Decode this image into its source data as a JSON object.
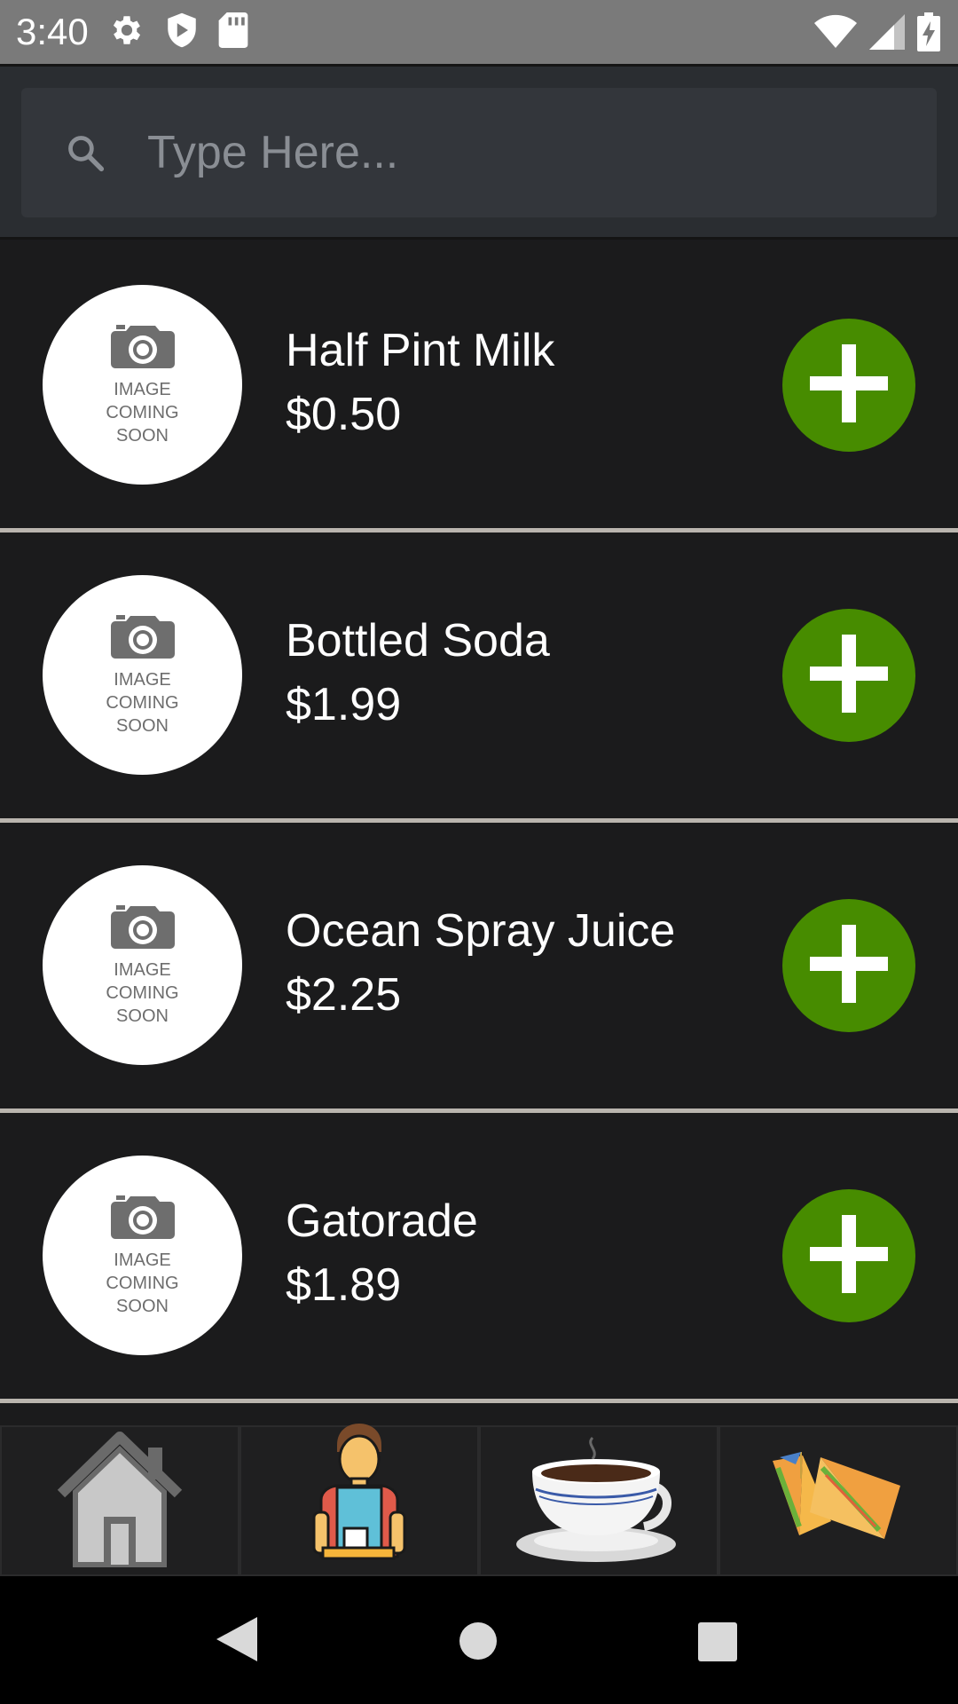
{
  "status_bar": {
    "time": "3:40",
    "icons_left": [
      "settings-icon",
      "shield-icon",
      "sd-card-icon"
    ],
    "icons_right": [
      "wifi-icon",
      "signal-icon",
      "battery-charging-icon"
    ]
  },
  "search": {
    "placeholder": "Type Here...",
    "value": "",
    "icon": "search-icon"
  },
  "products": [
    {
      "name": "Half Pint Milk",
      "price": "$0.50",
      "image_text": "IMAGE\nCOMING\nSOON"
    },
    {
      "name": "Bottled Soda",
      "price": "$1.99",
      "image_text": "IMAGE\nCOMING\nSOON"
    },
    {
      "name": "Ocean Spray Juice",
      "price": "$2.25",
      "image_text": "IMAGE\nCOMING\nSOON"
    },
    {
      "name": "Gatorade",
      "price": "$1.89",
      "image_text": "IMAGE\nCOMING\nSOON"
    }
  ],
  "tabs": [
    {
      "name": "home",
      "icon": "house-icon"
    },
    {
      "name": "barista",
      "icon": "barista-icon"
    },
    {
      "name": "coffee",
      "icon": "coffee-cup-icon"
    },
    {
      "name": "sandwich",
      "icon": "sandwich-icon"
    }
  ],
  "colors": {
    "add_button": "#478c00",
    "background": "#1b1b1c",
    "header": "#2a2d31",
    "divider": "#bab5ae"
  },
  "nav_bar": {
    "buttons": [
      "back-icon",
      "home-circle-icon",
      "recents-icon"
    ]
  }
}
